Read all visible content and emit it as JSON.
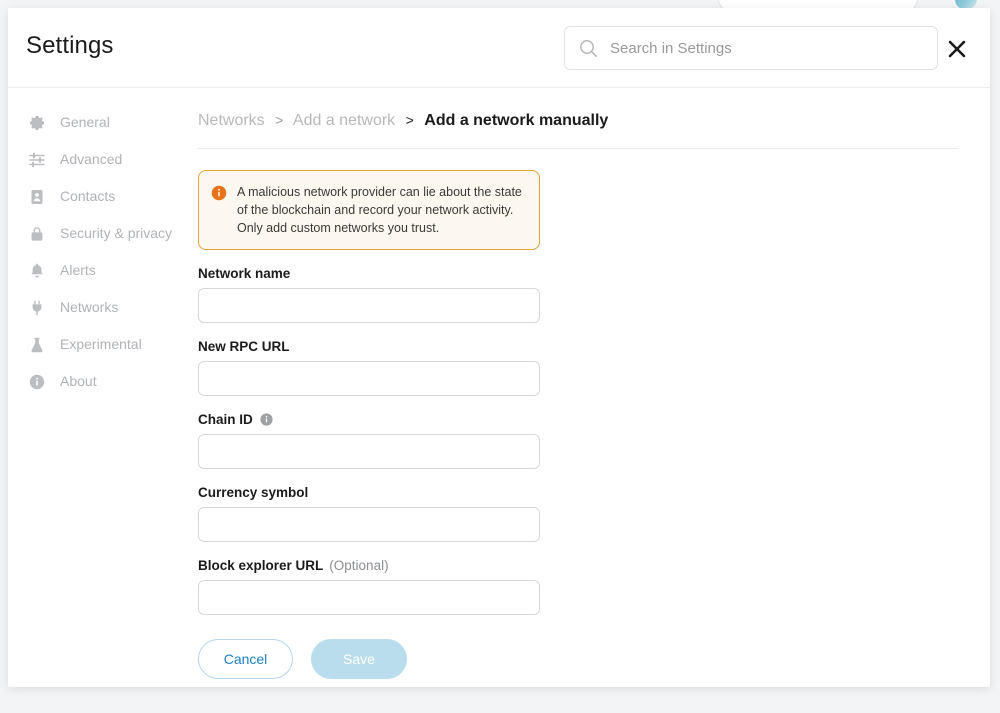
{
  "background": {
    "pill_name": "background-pill",
    "avatar_name": "background-account-avatar"
  },
  "header": {
    "title": "Settings",
    "search": {
      "placeholder": "Search in Settings",
      "value": "",
      "icon": "search-icon"
    },
    "close_icon": "close-icon"
  },
  "sidebar": {
    "items": [
      {
        "label": "General",
        "icon": "gear-icon"
      },
      {
        "label": "Advanced",
        "icon": "sliders-icon"
      },
      {
        "label": "Contacts",
        "icon": "contact-card-icon"
      },
      {
        "label": "Security & privacy",
        "icon": "lock-icon"
      },
      {
        "label": "Alerts",
        "icon": "bell-icon"
      },
      {
        "label": "Networks",
        "icon": "plug-icon"
      },
      {
        "label": "Experimental",
        "icon": "flask-icon"
      },
      {
        "label": "About",
        "icon": "info-circle-icon"
      }
    ]
  },
  "breadcrumb": {
    "root": "Networks",
    "separator": ">",
    "parent": "Add a network",
    "current": "Add a network manually"
  },
  "warning": {
    "icon": "warning-info-icon",
    "text": "A malicious network provider can lie about the state of the blockchain and record your network activity. Only add custom networks you trust.",
    "accent_color": "#e2a13a",
    "background_color": "#fdf8ef",
    "icon_color": "#e8731a"
  },
  "form": {
    "fields": [
      {
        "label": "Network name",
        "value": "",
        "placeholder": "",
        "optional": "",
        "info": false
      },
      {
        "label": "New RPC URL",
        "value": "",
        "placeholder": "",
        "optional": "",
        "info": false
      },
      {
        "label": "Chain ID",
        "value": "",
        "placeholder": "",
        "optional": "",
        "info": true
      },
      {
        "label": "Currency symbol",
        "value": "",
        "placeholder": "",
        "optional": "",
        "info": false
      },
      {
        "label": "Block explorer URL",
        "value": "",
        "placeholder": "",
        "optional": "(Optional)",
        "info": false
      }
    ],
    "info_icon": "info-circle-icon"
  },
  "actions": {
    "cancel_label": "Cancel",
    "save_label": "Save",
    "cancel_color": "#1c7fc4",
    "save_color": "#badded",
    "save_disabled": true
  }
}
